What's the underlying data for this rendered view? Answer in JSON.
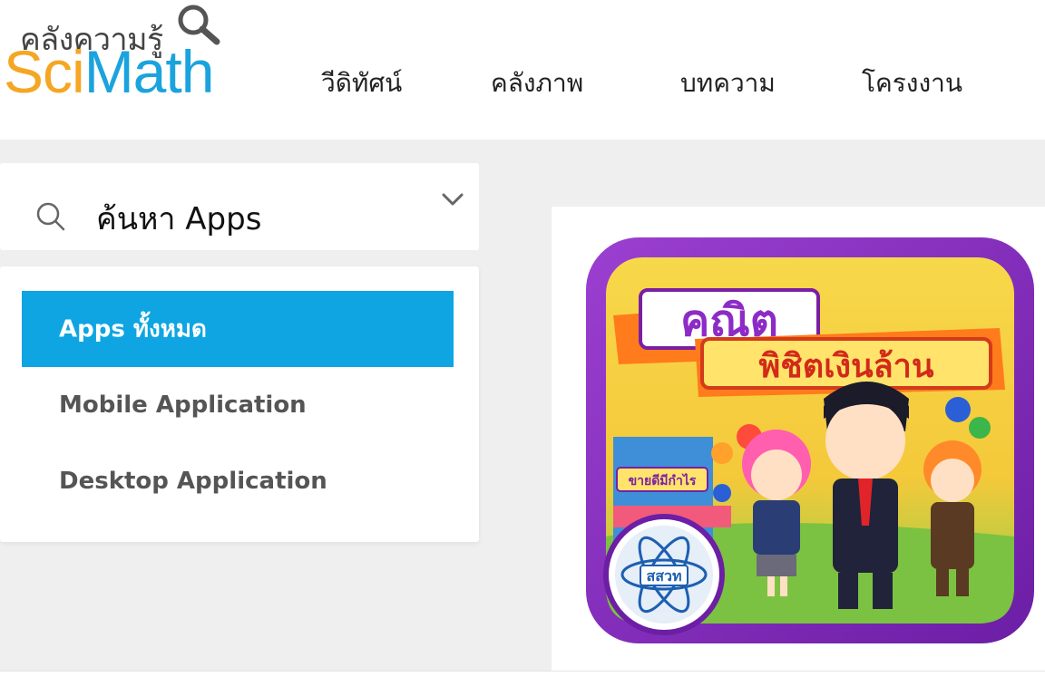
{
  "logo": {
    "top_text": "คลังความรู้",
    "sci": "Sci",
    "math": "Math"
  },
  "nav": {
    "items": [
      {
        "label": "วีดิทัศน์"
      },
      {
        "label": "คลังภาพ"
      },
      {
        "label": "บทความ"
      },
      {
        "label": "โครงงาน"
      }
    ]
  },
  "search": {
    "label": "ค้นหา Apps",
    "icon": "search-icon",
    "dropdown_icon": "chevron-down-icon"
  },
  "filters": {
    "items": [
      {
        "label": "Apps ทั้งหมด",
        "active": true
      },
      {
        "label": "Mobile Application",
        "active": false
      },
      {
        "label": "Desktop Application",
        "active": false
      }
    ]
  },
  "app": {
    "title_line1": "คณิต",
    "title_line2": "พิชิตเงินล้าน",
    "shop_sign": "ขายดีมีกำไร",
    "badge": "สสวท"
  },
  "colors": {
    "accent": "#0ea5e2",
    "logo_orange": "#f5a623",
    "logo_blue": "#1ba3dd",
    "background_grey": "#efefef",
    "icon_frame_purple": "#8a2bc0"
  }
}
